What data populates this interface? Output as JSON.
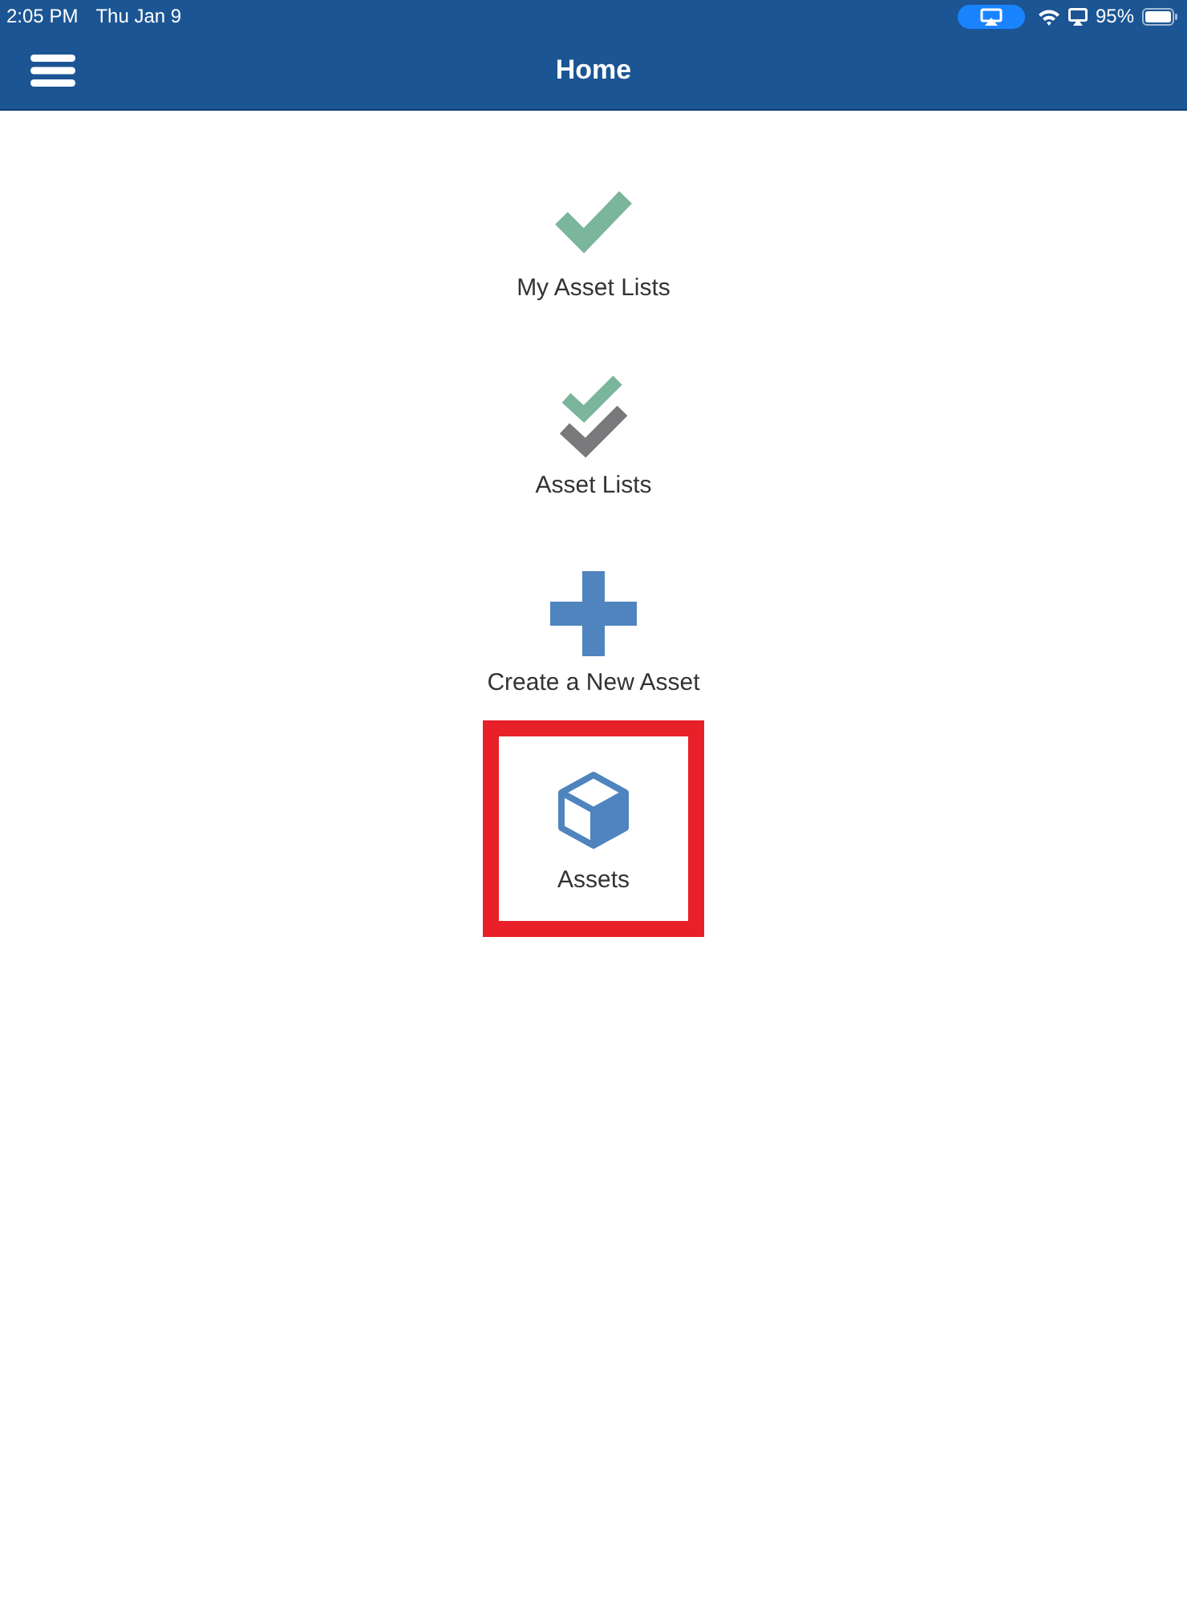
{
  "status_bar": {
    "time": "2:05 PM",
    "date": "Thu Jan 9",
    "battery": "95%"
  },
  "nav_bar": {
    "title": "Home"
  },
  "menu": [
    {
      "kind": "check",
      "label": "My Asset Lists",
      "highlighted": false
    },
    {
      "kind": "double-check",
      "label": "Asset Lists",
      "highlighted": false
    },
    {
      "kind": "plus",
      "label": "Create a New Asset",
      "highlighted": false
    },
    {
      "kind": "cube",
      "label": "Assets",
      "highlighted": true
    }
  ]
}
